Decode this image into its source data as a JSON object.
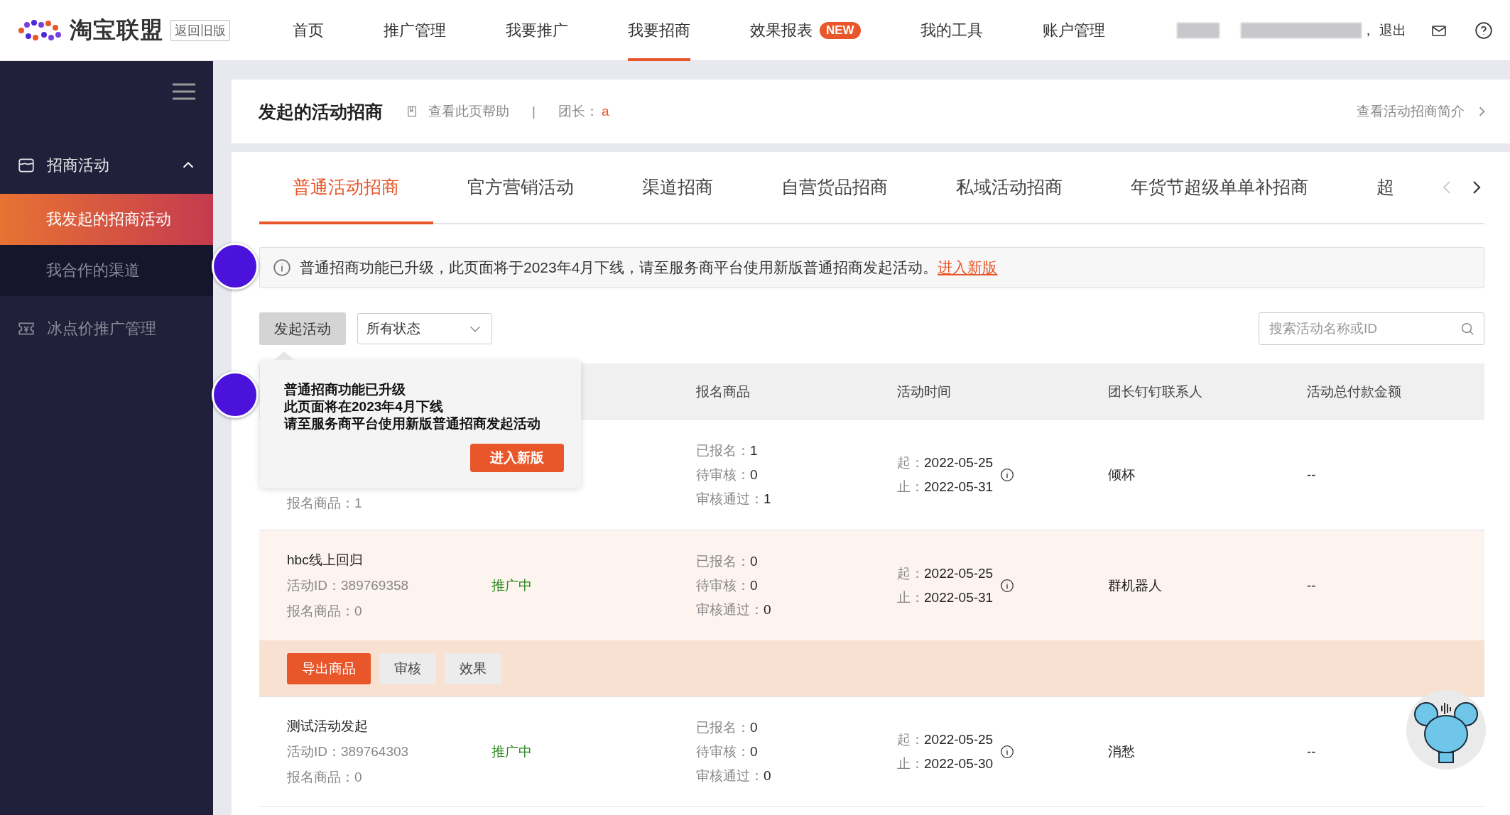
{
  "topbar": {
    "logo": "淘宝联盟",
    "old_version": "返回旧版",
    "nav": [
      {
        "label": "首页",
        "selected": false
      },
      {
        "label": "推广管理",
        "selected": false
      },
      {
        "label": "我要推广",
        "selected": false
      },
      {
        "label": "我要招商",
        "selected": true
      },
      {
        "label": "效果报表",
        "selected": false,
        "badge": "NEW"
      },
      {
        "label": "我的工具",
        "selected": false
      },
      {
        "label": "账户管理",
        "selected": false
      }
    ],
    "separator": "，",
    "logout": "退出"
  },
  "sidebar": {
    "items": [
      {
        "label": "招商活动",
        "expanded": true,
        "children": [
          {
            "label": "我发起的招商活动",
            "selected": true
          },
          {
            "label": "我合作的渠道",
            "selected": false
          }
        ]
      },
      {
        "label": "冰点价推广管理",
        "expanded": false
      }
    ]
  },
  "header": {
    "title": "发起的活动招商",
    "help": "查看此页帮助",
    "divider": "|",
    "leader_label": "团长：",
    "leader": "a",
    "intro_link": "查看活动招商简介"
  },
  "tabs": [
    {
      "label": "普通活动招商",
      "selected": true
    },
    {
      "label": "官方营销活动",
      "selected": false
    },
    {
      "label": "渠道招商",
      "selected": false
    },
    {
      "label": "自营货品招商",
      "selected": false
    },
    {
      "label": "私域活动招商",
      "selected": false
    },
    {
      "label": "年货节超级单单补招商",
      "selected": false
    },
    {
      "label": "超",
      "selected": false
    }
  ],
  "notice": {
    "text": "普通招商功能已升级，此页面将于2023年4月下线，请至服务商平台使用新版普通招商发起活动。",
    "link": "进入新版"
  },
  "toolbar": {
    "create_button": "发起活动",
    "status_select": "所有状态",
    "search": {
      "placeholder": "搜索活动名称或ID"
    }
  },
  "tooltip": {
    "lines": [
      "普通招商功能已升级",
      "此页面将在2023年4月下线",
      "请至服务商平台使用新版普通招商发起活动"
    ],
    "button": "进入新版"
  },
  "table": {
    "columns": [
      "报名商品",
      "活动时间",
      "团长钉钉联系人",
      "活动总付款金额"
    ],
    "rows": [
      {
        "expanded": false,
        "products": "报名商品：1",
        "stats": [
          {
            "label": "已报名：",
            "value": "1"
          },
          {
            "label": "待审核：",
            "value": "0"
          },
          {
            "label": "审核通过：",
            "value": "1"
          }
        ],
        "start_label": "起：",
        "start": "2022-05-25",
        "end_label": "止：",
        "end": "2022-05-31",
        "contact": "倾杯",
        "amount": "--"
      },
      {
        "expanded": true,
        "name": "hbc线上回归",
        "id": "活动ID：389769358",
        "products": "报名商品：0",
        "status": "推广中",
        "stats": [
          {
            "label": "已报名：",
            "value": "0"
          },
          {
            "label": "待审核：",
            "value": "0"
          },
          {
            "label": "审核通过：",
            "value": "0"
          }
        ],
        "start_label": "起：",
        "start": "2022-05-25",
        "end_label": "止：",
        "end": "2022-05-31",
        "contact": "群机器人",
        "amount": "--",
        "actions": [
          {
            "label": "导出商品",
            "kind": "primary"
          },
          {
            "label": "审核",
            "kind": "default"
          },
          {
            "label": "效果",
            "kind": "default"
          }
        ]
      },
      {
        "expanded": false,
        "name": "测试活动发起",
        "id": "活动ID：389764303",
        "products": "报名商品：0",
        "status": "推广中",
        "stats": [
          {
            "label": "已报名：",
            "value": "0"
          },
          {
            "label": "待审核：",
            "value": "0"
          },
          {
            "label": "审核通过：",
            "value": "0"
          }
        ],
        "start_label": "起：",
        "start": "2022-05-25",
        "end_label": "止：",
        "end": "2022-05-30",
        "contact": "消愁",
        "amount": "--"
      }
    ]
  }
}
